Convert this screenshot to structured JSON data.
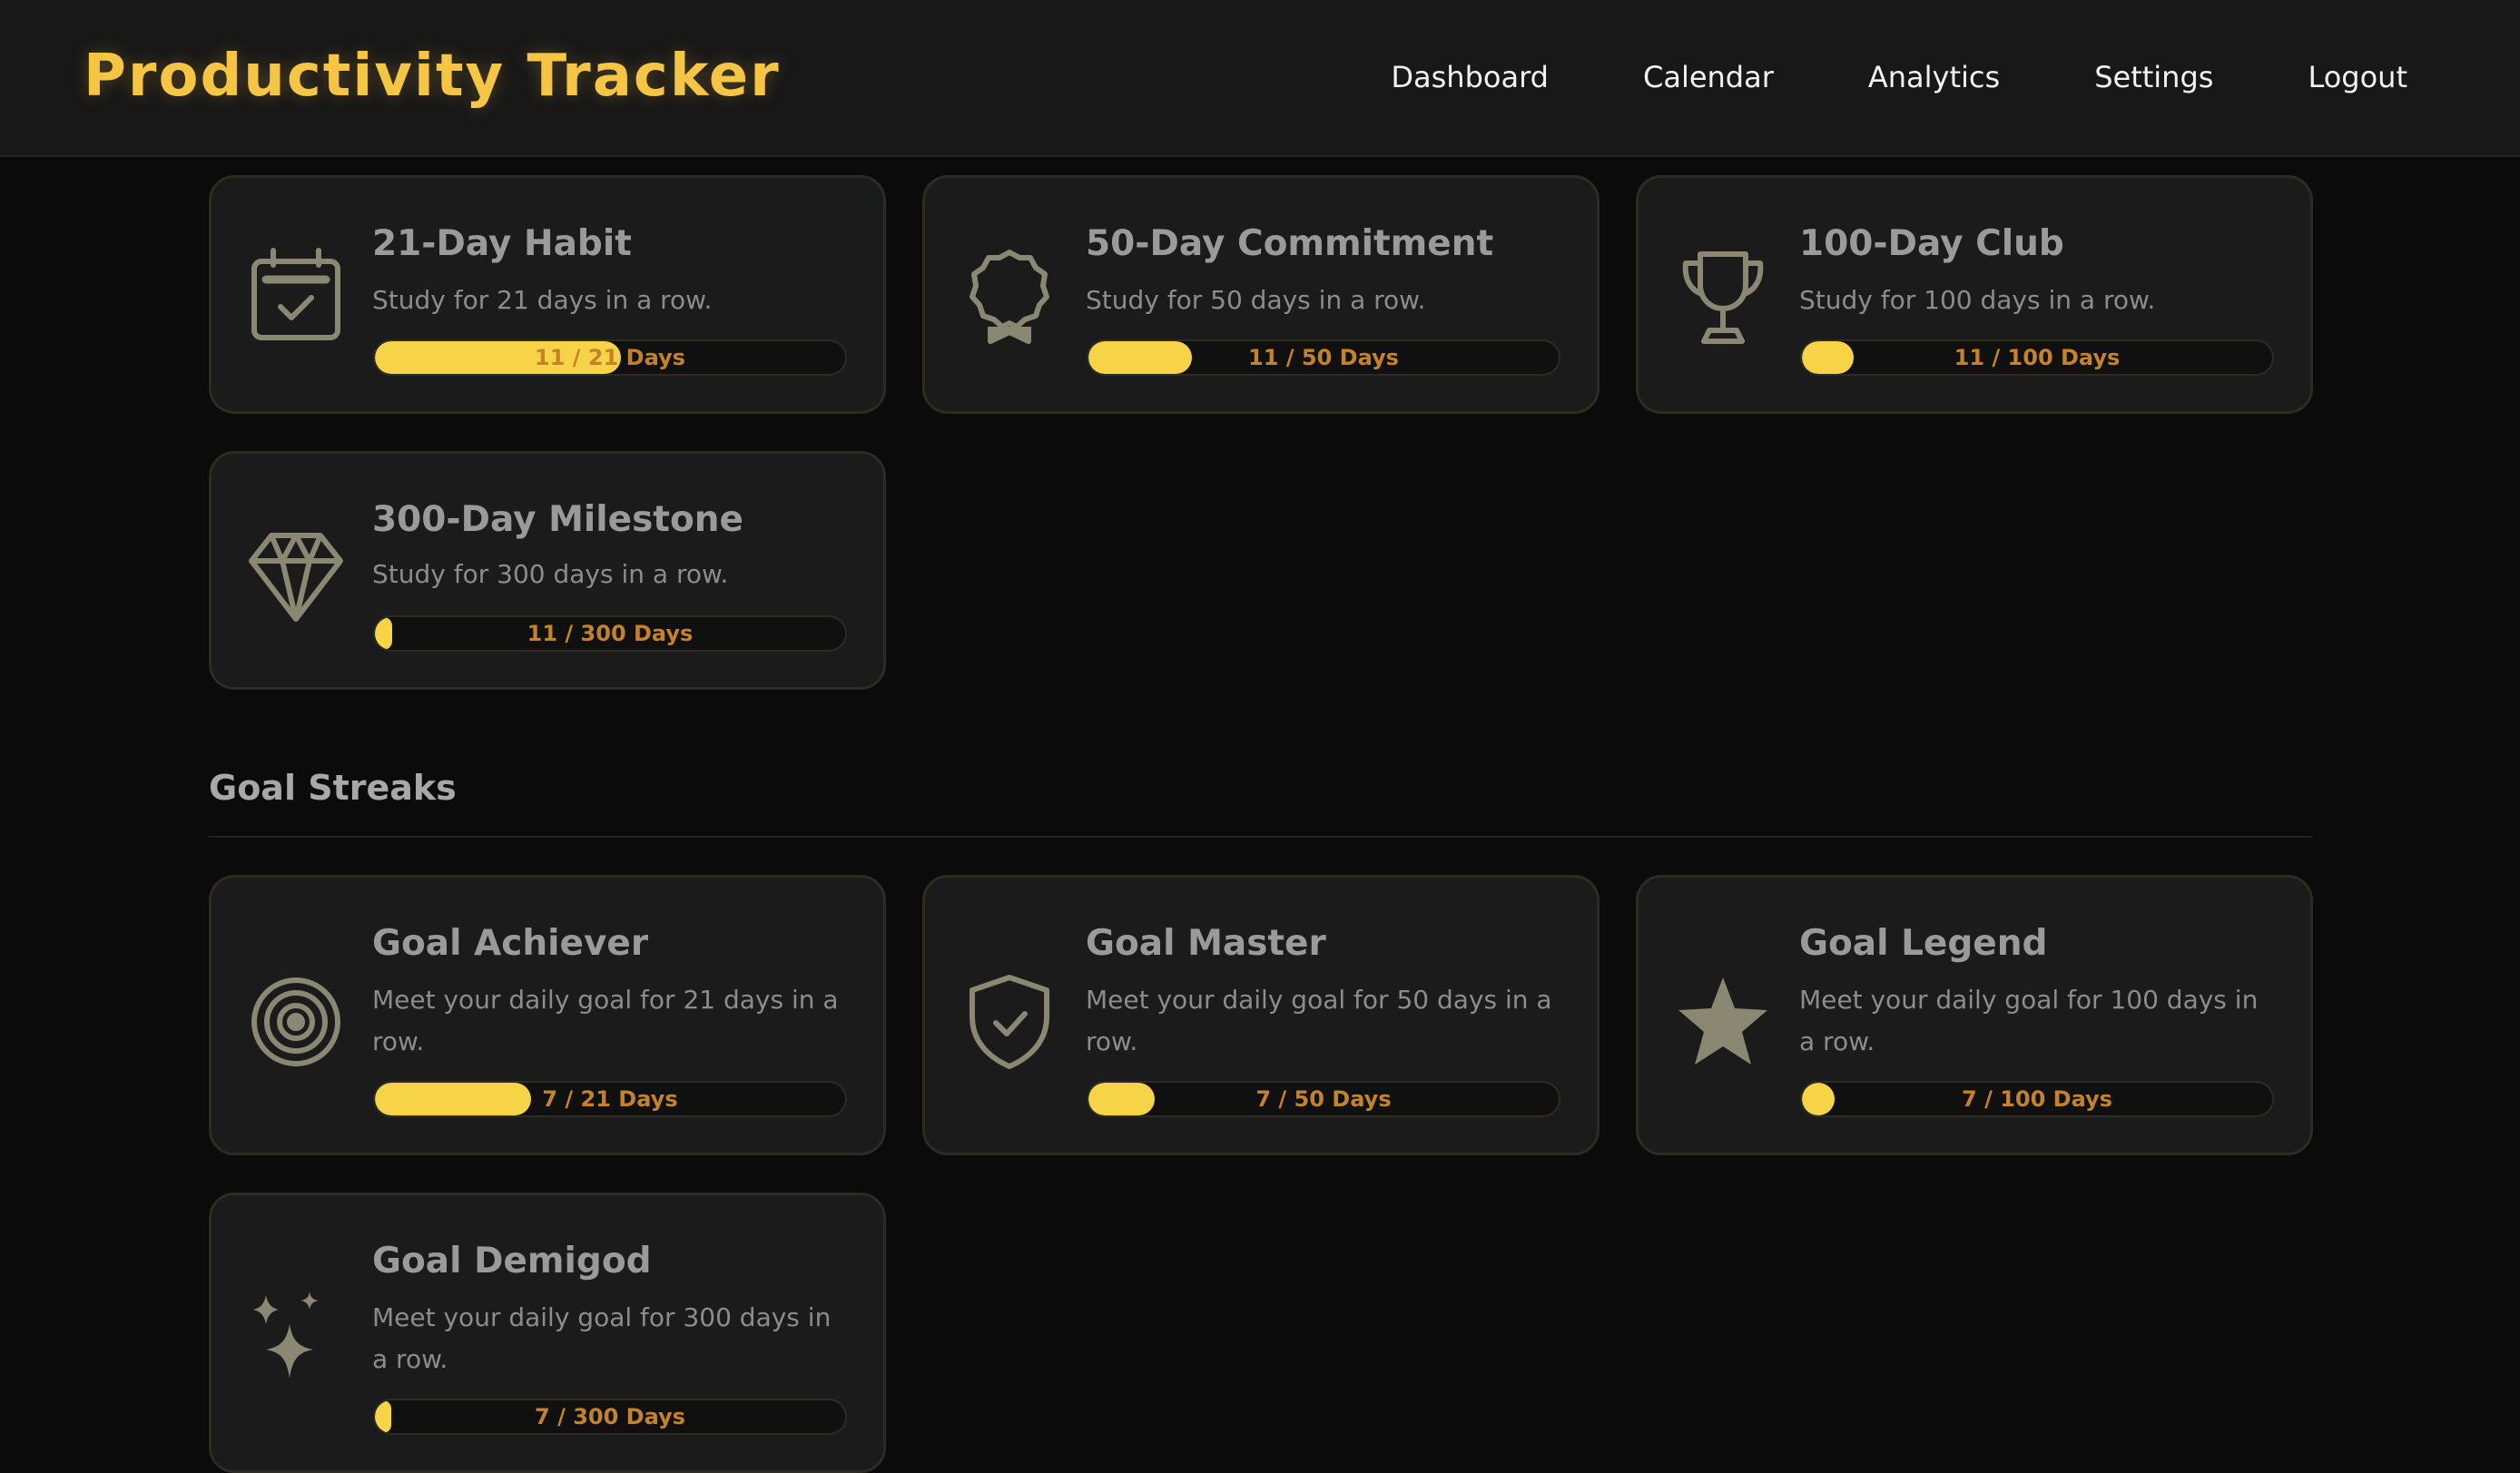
{
  "app": {
    "title": "Productivity Tracker"
  },
  "nav": {
    "items": [
      {
        "label": "Dashboard"
      },
      {
        "label": "Calendar"
      },
      {
        "label": "Analytics"
      },
      {
        "label": "Settings"
      },
      {
        "label": "Logout"
      }
    ]
  },
  "colors": {
    "accent": "#f6c544",
    "progress_fill": "#f7d447",
    "progress_label": "#c4822a",
    "card_bg": "#1b1b1b",
    "page_bg": "#0b0b0b"
  },
  "study_streaks": {
    "cards": [
      {
        "icon": "calendar-check-icon",
        "title": "21-Day Habit",
        "description": "Study for 21 days in a row.",
        "progress": 0.524,
        "progress_label": "11 / 21 Days"
      },
      {
        "icon": "award-badge-icon",
        "title": "50-Day Commitment",
        "description": "Study for 50 days in a row.",
        "progress": 0.22,
        "progress_label": "11 / 50 Days"
      },
      {
        "icon": "trophy-icon",
        "title": "100-Day Club",
        "description": "Study for 100 days in a row.",
        "progress": 0.11,
        "progress_label": "11 / 100 Days"
      },
      {
        "icon": "diamond-icon",
        "title": "300-Day Milestone",
        "description": "Study for 300 days in a row.",
        "progress": 0.037,
        "progress_label": "11 / 300 Days"
      }
    ]
  },
  "goal_streaks": {
    "heading": "Goal Streaks",
    "cards": [
      {
        "icon": "target-icon",
        "title": "Goal Achiever",
        "description": "Meet your daily goal for 21 days in a row.",
        "progress": 0.333,
        "progress_label": "7 / 21 Days"
      },
      {
        "icon": "shield-check-icon",
        "title": "Goal Master",
        "description": "Meet your daily goal for 50 days in a row.",
        "progress": 0.14,
        "progress_label": "7 / 50 Days"
      },
      {
        "icon": "star-icon",
        "title": "Goal Legend",
        "description": "Meet your daily goal for 100 days in a row.",
        "progress": 0.07,
        "progress_label": "7 / 100 Days"
      },
      {
        "icon": "sparkles-icon",
        "title": "Goal Demigod",
        "description": "Meet your daily goal for 300 days in a row.",
        "progress": 0.023,
        "progress_label": "7 / 300 Days"
      }
    ]
  }
}
